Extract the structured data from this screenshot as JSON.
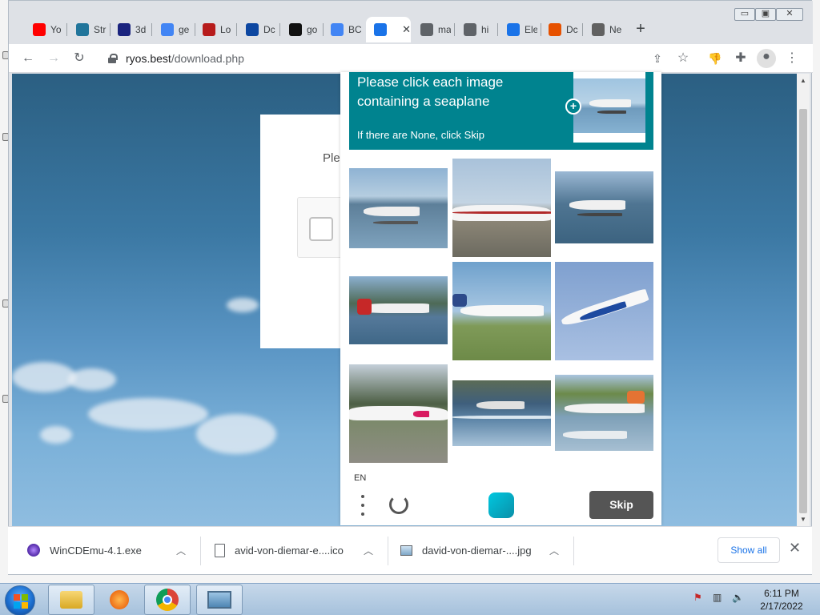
{
  "browser": {
    "tabs": [
      {
        "label": "Yo",
        "icon": "youtube-icon",
        "color": "#ff0000"
      },
      {
        "label": "Str",
        "icon": "wordpress-icon",
        "color": "#21759b"
      },
      {
        "label": "3d",
        "icon": "n-logo-icon",
        "color": "#1a237e"
      },
      {
        "label": "ge",
        "icon": "google-icon",
        "color": "#4285f4"
      },
      {
        "label": "Lo",
        "icon": "bird-icon",
        "color": "#b71c1c"
      },
      {
        "label": "Dc",
        "icon": "big-logo-icon",
        "color": "#0d47a1"
      },
      {
        "label": "go",
        "icon": "unsplash-icon",
        "color": "#111111"
      },
      {
        "label": "BC",
        "icon": "google-icon",
        "color": "#4285f4"
      },
      {
        "label": "",
        "icon": "chrome-blue-icon",
        "color": "#1a73e8"
      },
      {
        "label": "ma",
        "icon": "globe-icon",
        "color": "#5f6368"
      },
      {
        "label": "hi",
        "icon": "globe-icon",
        "color": "#5f6368"
      },
      {
        "label": "Ele",
        "icon": "chrome-blue-icon",
        "color": "#1a73e8"
      },
      {
        "label": "Dc",
        "icon": "orange-icon",
        "color": "#e65100"
      },
      {
        "label": "Ne",
        "icon": "grey-circle-icon",
        "color": "#616161"
      }
    ],
    "url_host": "ryos.best",
    "url_path": "/download.php"
  },
  "page": {
    "card_text": "Ple"
  },
  "captcha": {
    "prompt": "Please click each image containing a seaplane",
    "hint": "If there are None, click Skip",
    "language": "EN",
    "skip_label": "Skip",
    "tiles": [
      "seaplane-docked",
      "airliner-on-tarmac",
      "seaplane-on-water",
      "seaplane-by-shore",
      "airliner-landing",
      "airliner-in-flight",
      "airliner-on-runway",
      "seaplane-taking-off",
      "seaplane-at-dock"
    ]
  },
  "downloads": {
    "items": [
      {
        "name": "WinCDEmu-4.1.exe",
        "icon": "wincdemu-icon"
      },
      {
        "name": "avid-von-diemar-e....ico",
        "icon": "file-icon"
      },
      {
        "name": "david-von-diemar-....jpg",
        "icon": "image-file-icon"
      }
    ],
    "show_all": "Show all"
  },
  "taskbar": {
    "time": "6:11 PM",
    "date": "2/17/2022"
  }
}
